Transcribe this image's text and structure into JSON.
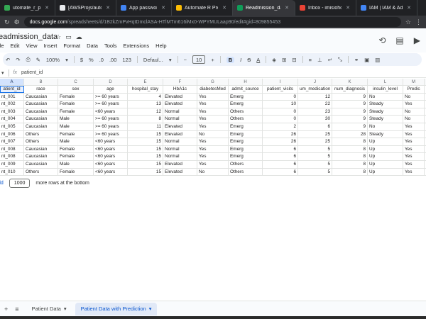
{
  "browser": {
    "tabs": [
      {
        "label": "utomate_r_proj - Vi",
        "color": "#34a853"
      },
      {
        "label": "[AWSProjs/automat",
        "color": "#e8eaed"
      },
      {
        "label": "App passwords",
        "color": "#4285f4"
      },
      {
        "label": "Automate R Projs -",
        "color": "#fbbc04"
      },
      {
        "label": "Readmission_data -",
        "color": "#0f9d58"
      },
      {
        "label": "Inbox - imisiohotit@",
        "color": "#ea4335"
      },
      {
        "label": "IAM | IAM & Admin",
        "color": "#4285f4"
      }
    ],
    "url_domain": "docs.google.com",
    "url_rest": "/spreadsheets/d/1B2kZmPvHqtDmclASA-HTlMTm616iMx0-WPYMULaap90/edit#gid=809855453"
  },
  "app": {
    "doc_title": "eadmission_data",
    "menus": [
      "ile",
      "Edit",
      "View",
      "Insert",
      "Format",
      "Data",
      "Tools",
      "Extensions",
      "Help"
    ]
  },
  "toolbar": {
    "zoom": "100%",
    "currency": "$",
    "percent": "%",
    "decimals_down": ".0",
    "decimals_up": ".00",
    "number_format": "123",
    "font": "Defaul...",
    "font_size": "10",
    "bold": "B"
  },
  "formula_bar": {
    "cell_ref": "▾",
    "fx": "fx",
    "content": "patient_id"
  },
  "sheet": {
    "columns": [
      "A",
      "B",
      "C",
      "D",
      "E",
      "F",
      "G",
      "H",
      "I",
      "J",
      "K",
      "L",
      "M"
    ],
    "header": [
      "atient_id",
      "race",
      "sex",
      "age",
      "hospital_stay",
      "HbA1c",
      "diabetesMed",
      "admit_source",
      "patient_visits",
      "um_medication",
      "num_diagnosis",
      "insulin_level",
      "Predic"
    ],
    "rows": [
      [
        "nt_001",
        "Caucasian",
        "Female",
        ">= 60 years",
        "4",
        "Elevated",
        "Yes",
        "Emerg",
        "0",
        "12",
        "9",
        "No",
        "No"
      ],
      [
        "nt_002",
        "Caucasian",
        "Female",
        ">= 60 years",
        "13",
        "Elevated",
        "Yes",
        "Emerg",
        "10",
        "22",
        "9",
        "Steady",
        "Yes"
      ],
      [
        "nt_003",
        "Caucasian",
        "Female",
        "<60 years",
        "12",
        "Normal",
        "Yes",
        "Others",
        "0",
        "23",
        "9",
        "Steady",
        "No"
      ],
      [
        "nt_004",
        "Caucasian",
        "Male",
        ">= 60 years",
        "8",
        "Normal",
        "Yes",
        "Others",
        "0",
        "30",
        "9",
        "Steady",
        "No"
      ],
      [
        "nt_005",
        "Caucasian",
        "Male",
        ">= 60 years",
        "11",
        "Elevated",
        "Yes",
        "Emerg",
        "2",
        "6",
        "9",
        "No",
        "Yes"
      ],
      [
        "nt_006",
        "Others",
        "Female",
        ">= 60 years",
        "15",
        "Elevated",
        "No",
        "Emerg",
        "26",
        "25",
        "28",
        "Steady",
        "Yes"
      ],
      [
        "nt_007",
        "Others",
        "Male",
        "<60 years",
        "15",
        "Normal",
        "Yes",
        "Emerg",
        "26",
        "25",
        "8",
        "Up",
        "Yes"
      ],
      [
        "nt_008",
        "Caucasian",
        "Female",
        "<60 years",
        "15",
        "Normal",
        "Yes",
        "Emerg",
        "6",
        "5",
        "8",
        "Up",
        "Yes"
      ],
      [
        "nt_008",
        "Caucasian",
        "Female",
        "<60 years",
        "15",
        "Normal",
        "Yes",
        "Emerg",
        "6",
        "5",
        "8",
        "Up",
        "Yes"
      ],
      [
        "nt_009",
        "Caucasian",
        "Male",
        "<60 years",
        "15",
        "Elevated",
        "Yes",
        "Others",
        "6",
        "5",
        "8",
        "Up",
        "Yes"
      ],
      [
        "nt_010",
        "Others",
        "Female",
        "<60 years",
        "15",
        "Elevated",
        "No",
        "Others",
        "6",
        "5",
        "8",
        "Up",
        "Yes"
      ]
    ],
    "add_link": "dd",
    "add_count": "1000",
    "add_suffix": "more rows at the bottom"
  },
  "sheets_bar": {
    "tabs": [
      "Patient Data",
      "Patient Data with Prediction"
    ]
  }
}
